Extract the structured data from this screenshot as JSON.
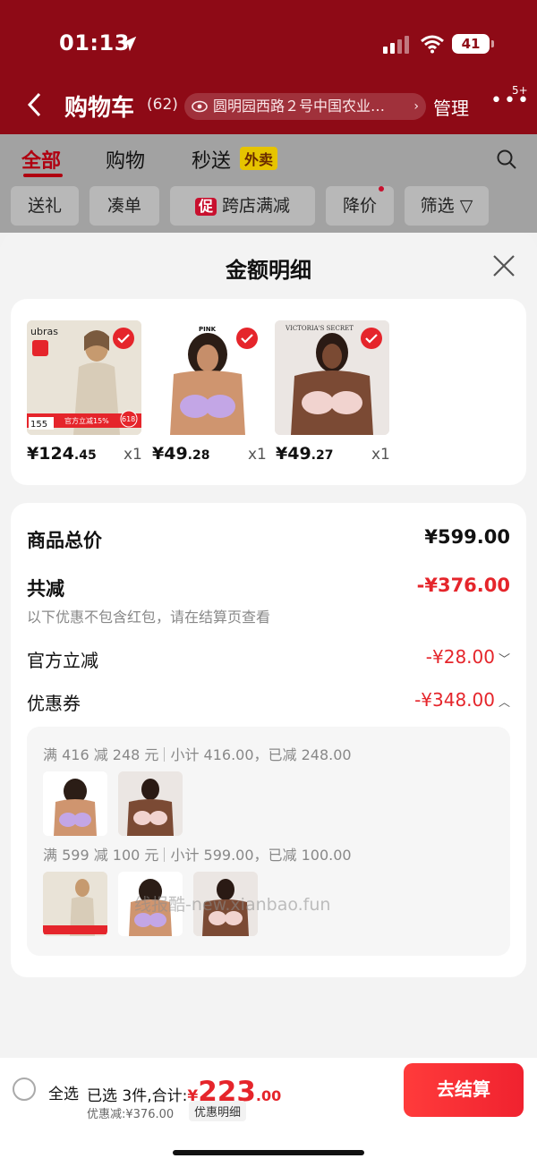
{
  "status_bar": {
    "time": "01:13",
    "battery": "41"
  },
  "header": {
    "back_label": "<",
    "title": "购物车",
    "count": "(62)",
    "address": "圆明园西路２号中国农业…",
    "manage": "管理",
    "more": "•••",
    "more_badge": "5+"
  },
  "tabs": [
    {
      "label": "全部"
    },
    {
      "label": "购物"
    },
    {
      "label": "秒送"
    }
  ],
  "takeout_badge": "外卖",
  "filters": [
    {
      "label": "送礼"
    },
    {
      "label": "凑单"
    },
    {
      "label": "跨店满减",
      "promo": "促"
    },
    {
      "label": "降价"
    },
    {
      "label": "筛选"
    }
  ],
  "sheet": {
    "title": "金额明细",
    "products": [
      {
        "brand": "ubras",
        "price_int": "¥124",
        "price_dec": ".45",
        "qty": "x1",
        "image": "beige-thermal-top",
        "tag": "官方立减15%",
        "badge": "618"
      },
      {
        "brand": "PINK",
        "price_int": "¥49",
        "price_dec": ".28",
        "qty": "x1",
        "image": "lavender-bra"
      },
      {
        "brand": "VICTORIA'S SECRET",
        "price_int": "¥49",
        "price_dec": ".27",
        "qty": "x1",
        "image": "pink-bra"
      }
    ],
    "total_label": "商品总价",
    "total_value": "¥599.00",
    "reduce_label": "共减",
    "reduce_value": "-¥376.00",
    "reduce_note": "以下优惠不包含红包，请在结算页查看",
    "official_label": "官方立减",
    "official_value": "-¥28.00",
    "coupon_label": "优惠券",
    "coupon_value": "-¥348.00",
    "coupon_rules": [
      {
        "rule": "满 416 减 248 元",
        "detail": "小计 416.00，已减 248.00"
      },
      {
        "rule": "满 599 减 100 元",
        "detail": "小计 599.00，已减 100.00"
      }
    ],
    "watermark": "线报酷-new.xianbao.fun"
  },
  "bottom_bar": {
    "select_all": "全选",
    "summary_prefix": "已选 3件,合计:",
    "amount_yuan": "¥",
    "amount_int": "223",
    "amount_dec": ".00",
    "discount": "优惠减:¥376.00",
    "detail_button": "优惠明细",
    "checkout": "去结算"
  },
  "colors": {
    "accent": "#e5252b",
    "header": "#8e0a16"
  }
}
